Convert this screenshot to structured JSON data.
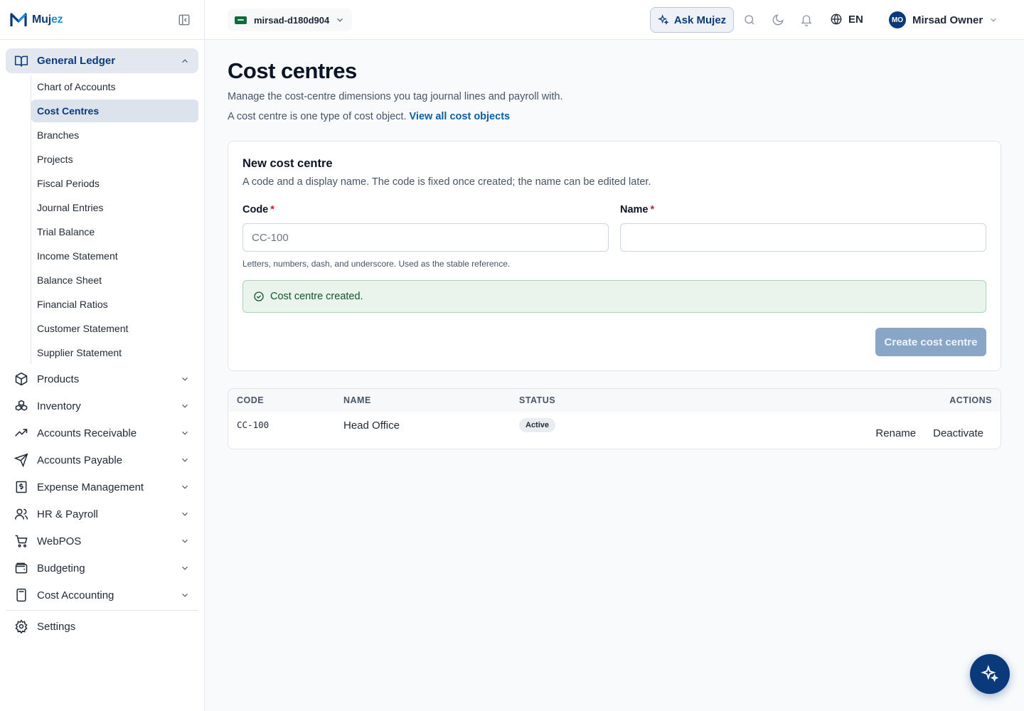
{
  "brand": {
    "name_part1": "Muj",
    "name_part2": "ez"
  },
  "sidebar": {
    "group": {
      "label": "General Ledger",
      "icon": "book-open-icon",
      "items": [
        {
          "label": "Chart of Accounts",
          "active": false
        },
        {
          "label": "Cost Centres",
          "active": true
        },
        {
          "label": "Branches",
          "active": false
        },
        {
          "label": "Projects",
          "active": false
        },
        {
          "label": "Fiscal Periods",
          "active": false
        },
        {
          "label": "Journal Entries",
          "active": false
        },
        {
          "label": "Trial Balance",
          "active": false
        },
        {
          "label": "Income Statement",
          "active": false
        },
        {
          "label": "Balance Sheet",
          "active": false
        },
        {
          "label": "Financial Ratios",
          "active": false
        },
        {
          "label": "Customer Statement",
          "active": false
        },
        {
          "label": "Supplier Statement",
          "active": false
        }
      ]
    },
    "modules": [
      {
        "label": "Products",
        "icon": "package-icon"
      },
      {
        "label": "Inventory",
        "icon": "boxes-icon"
      },
      {
        "label": "Accounts Receivable",
        "icon": "trending-up-icon"
      },
      {
        "label": "Accounts Payable",
        "icon": "send-icon"
      },
      {
        "label": "Expense Management",
        "icon": "receipt-dollar-icon"
      },
      {
        "label": "HR & Payroll",
        "icon": "users-icon"
      },
      {
        "label": "WebPOS",
        "icon": "cart-icon"
      },
      {
        "label": "Budgeting",
        "icon": "wallet-icon"
      },
      {
        "label": "Cost Accounting",
        "icon": "calculator-icon"
      }
    ],
    "settings_label": "Settings"
  },
  "topbar": {
    "org_name": "mirsad-d180d904",
    "ask_label": "Ask Mujez",
    "language": "EN",
    "user_initials": "MO",
    "user_name": "Mirsad Owner"
  },
  "page": {
    "title": "Cost centres",
    "description": "Manage the cost-centre dimensions you tag journal lines and payroll with.",
    "description2": "A cost centre is one type of cost object.",
    "link_label": "View all cost objects"
  },
  "form": {
    "title": "New cost centre",
    "subtitle": "A code and a display name. The code is fixed once created; the name can be edited later.",
    "code_label": "Code",
    "code_placeholder": "CC-100",
    "code_value": "",
    "name_label": "Name",
    "name_placeholder": "",
    "name_value": "",
    "required_mark": "*",
    "code_hint": "Letters, numbers, dash, and underscore. Used as the stable reference.",
    "success_message": "Cost centre created.",
    "submit_label": "Create cost centre"
  },
  "table": {
    "headers": {
      "code": "CODE",
      "name": "NAME",
      "status": "STATUS",
      "actions": "ACTIONS"
    },
    "rows": [
      {
        "code": "CC-100",
        "name": "Head Office",
        "status": "Active",
        "actions": [
          "Rename",
          "Deactivate"
        ]
      }
    ]
  },
  "colors": {
    "brand_navy": "#0b3a7a",
    "brand_blue": "#1a8cd8",
    "success_bg": "#e8f4ec",
    "active_nav_bg": "#dde3ec"
  }
}
